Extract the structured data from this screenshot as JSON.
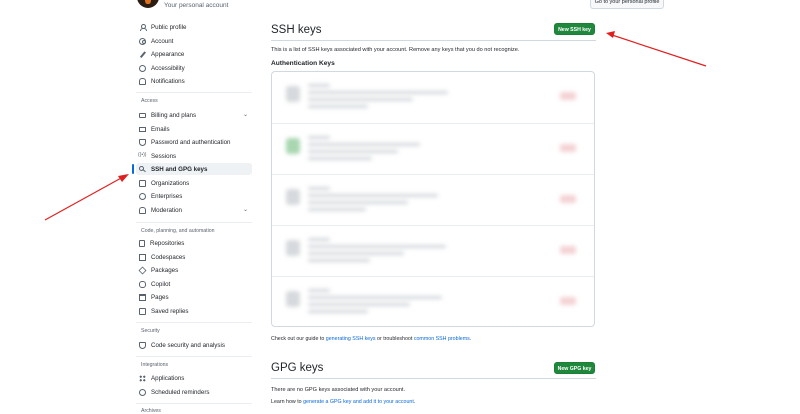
{
  "header": {
    "user_name": "",
    "user_subtitle": "Your personal account",
    "go_profile_label": "Go to your personal profile"
  },
  "sidebar": {
    "items_top": [
      {
        "label": "Public profile",
        "icon": "person-icon"
      },
      {
        "label": "Account",
        "icon": "gear-icon"
      },
      {
        "label": "Appearance",
        "icon": "paintbrush-icon"
      },
      {
        "label": "Accessibility",
        "icon": "accessibility-icon"
      },
      {
        "label": "Notifications",
        "icon": "bell-icon"
      }
    ],
    "access_label": "Access",
    "items_access": [
      {
        "label": "Billing and plans",
        "icon": "credit-card-icon",
        "chevron": true
      },
      {
        "label": "Emails",
        "icon": "mail-icon"
      },
      {
        "label": "Password and authentication",
        "icon": "shield-lock-icon"
      },
      {
        "label": "Sessions",
        "icon": "broadcast-icon"
      },
      {
        "label": "SSH and GPG keys",
        "icon": "key-icon",
        "active": true
      },
      {
        "label": "Organizations",
        "icon": "organization-icon"
      },
      {
        "label": "Enterprises",
        "icon": "globe-icon"
      },
      {
        "label": "Moderation",
        "icon": "report-icon",
        "chevron": true
      }
    ],
    "code_label": "Code, planning, and automation",
    "items_code": [
      {
        "label": "Repositories",
        "icon": "repo-icon"
      },
      {
        "label": "Codespaces",
        "icon": "codespaces-icon"
      },
      {
        "label": "Packages",
        "icon": "package-icon"
      },
      {
        "label": "Copilot",
        "icon": "copilot-icon"
      },
      {
        "label": "Pages",
        "icon": "browser-icon"
      },
      {
        "label": "Saved replies",
        "icon": "reply-icon"
      }
    ],
    "security_label": "Security",
    "items_security": [
      {
        "label": "Code security and analysis",
        "icon": "shield-icon"
      }
    ],
    "integrations_label": "Integrations",
    "items_integrations": [
      {
        "label": "Applications",
        "icon": "apps-icon"
      },
      {
        "label": "Scheduled reminders",
        "icon": "clock-icon"
      }
    ],
    "archives_label": "Archives"
  },
  "ssh": {
    "title": "SSH keys",
    "new_button": "New SSH key",
    "description": "This is a list of SSH keys associated with your account. Remove any keys that you do not recognize.",
    "auth_heading": "Authentication Keys",
    "footer_prefix": "Check out our guide to ",
    "footer_link1": "generating SSH keys",
    "footer_mid": " or troubleshoot ",
    "footer_link2": "common SSH problems",
    "footer_suffix": "."
  },
  "gpg": {
    "title": "GPG keys",
    "new_button": "New GPG key",
    "empty_text": "There are no GPG keys associated with your account.",
    "learn_prefix": "Learn how to ",
    "learn_link": "generate a GPG key and add it to your account",
    "learn_suffix": "."
  },
  "colors": {
    "accent": "#0969da",
    "primary_button": "#1f883d",
    "annotation_arrow": "#e02020"
  }
}
